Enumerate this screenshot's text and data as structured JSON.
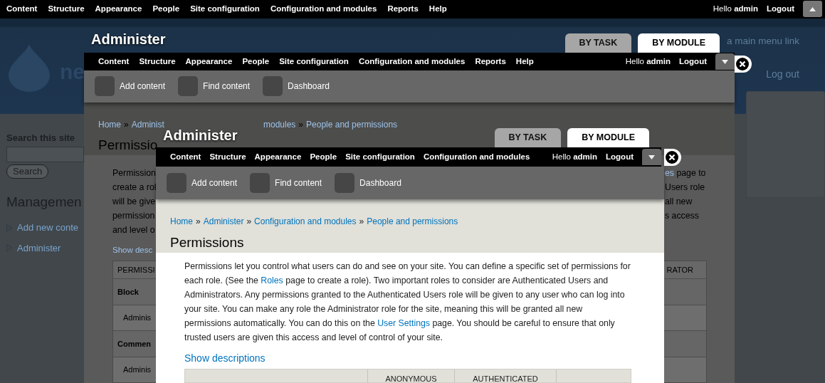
{
  "site": {
    "toolbar": {
      "menu": [
        "Content",
        "Structure",
        "Appearance",
        "People",
        "Site configuration",
        "Configuration and modules",
        "Reports",
        "Help"
      ],
      "greeting": "Hello **admin**",
      "logout": "Logout",
      "drawer_open": false
    },
    "header": {
      "site_name": "ne",
      "menu_hint": "a main menu link",
      "logout": "Log out"
    },
    "sidebar": {
      "search_title": "Search this site",
      "search_button": "Search",
      "heading": "Managemen",
      "links": [
        "Add new conte",
        "Administer"
      ]
    }
  },
  "outer_overlay": {
    "title": "Administer",
    "tabs": [
      {
        "label": "BY TASK",
        "selected": false
      },
      {
        "label": "BY MODULE",
        "selected": true
      }
    ],
    "toolbar": {
      "menu": [
        "Content",
        "Structure",
        "Appearance",
        "People",
        "Site configuration",
        "Configuration and modules",
        "Reports",
        "Help"
      ],
      "greeting": "Hello **admin**",
      "logout": "Logout",
      "drawer_open": true
    },
    "shortcuts": [
      "Add content",
      "Find content",
      "Dashboard"
    ],
    "separator": "»",
    "breadcrumb_start": [
      "Home",
      "Administ"
    ],
    "breadcrumb_end": [
      "modules",
      "People and permissions"
    ],
    "page_title": "Permissio",
    "text_left": [
      "Permission",
      "create a rol",
      "will be give",
      "permission",
      "and level o"
    ],
    "text_right": [
      [
        {
          "text": "es",
          "link": true
        },
        {
          "text": " page to",
          "link": false
        }
      ],
      [
        {
          "text": "Users role",
          "link": false
        }
      ],
      [
        {
          "text": "all new",
          "link": false
        }
      ],
      [
        {
          "text": "s access",
          "link": false
        }
      ]
    ],
    "show_link": "Show desc",
    "table": {
      "header_start": "PERMISSI",
      "header_end": "RATOR",
      "rows": [
        {
          "kind": "module",
          "text": "Block"
        },
        {
          "kind": "permission",
          "text": "Adminis"
        },
        {
          "kind": "module",
          "text": "Commen"
        },
        {
          "kind": "permission",
          "text": "Adminis"
        }
      ]
    }
  },
  "inner_overlay": {
    "title": "Administer",
    "tabs": [
      {
        "label": "BY TASK",
        "selected": false
      },
      {
        "label": "BY MODULE",
        "selected": true
      }
    ],
    "toolbar": {
      "menu": [
        "Content",
        "Structure",
        "Appearance",
        "People",
        "Site configuration",
        "Configuration and modules"
      ],
      "greeting": "Hello **admin**",
      "logout": "Logout",
      "drawer_open": true
    },
    "shortcuts": [
      "Add content",
      "Find content",
      "Dashboard"
    ],
    "separator": "»",
    "breadcrumb": [
      "Home",
      "Administer",
      "Configuration and modules",
      "People and permissions"
    ],
    "page_title": "Permissions",
    "intro": [
      {
        "text": "Permissions let you control what users can do and see on your site. You can define a specific set of permissions for each role. (See the ",
        "link": false
      },
      {
        "text": "Roles",
        "link": true
      },
      {
        "text": " page to create a role). Two important roles to consider are Authenticated Users and Administrators. Any permissions granted to the Authenticated Users role will be given to any user who can log into your site. You can make any role the Administrator role for the site, meaning this will be granted all new permissions automatically. You can do this on the ",
        "link": false
      },
      {
        "text": "User Settings",
        "link": true
      },
      {
        "text": " page. You should be careful to ensure that only trusted users are given this access and level of control of your site.",
        "link": false
      }
    ],
    "show_link": "Show descriptions",
    "table": {
      "columns": [
        "ANONYMOUS",
        "AUTHENTICATED"
      ]
    }
  }
}
